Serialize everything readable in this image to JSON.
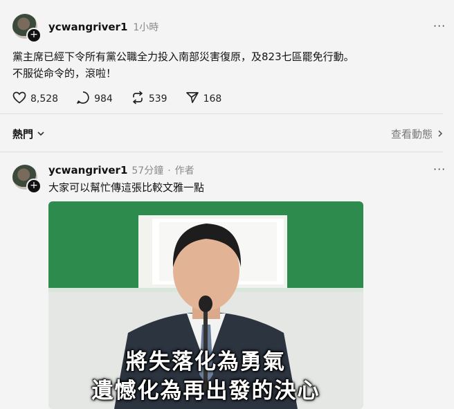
{
  "post": {
    "username": "ycwangriver1",
    "time": "1小時",
    "text_line1": "黨主席已經下令所有黨公職全力投入南部災害復原，及823七區罷免行動。",
    "text_line2": "不服從命令的，滾啦！",
    "likes": "8,528",
    "comments": "984",
    "reposts": "539",
    "shares": "168",
    "more_label": "···"
  },
  "replies_bar": {
    "sort_label": "熱門",
    "activity_label": "查看動態"
  },
  "reply": {
    "username": "ycwangriver1",
    "time": "57分鐘",
    "separator": "·",
    "author_tag": "作者",
    "text": "大家可以幫忙傳這張比較文雅一點",
    "more_label": "···",
    "image_caption_line1": "將失落化為勇氣",
    "image_caption_line2": "遺憾化為再出發的決心"
  },
  "icons": [
    "heart-icon",
    "comment-icon",
    "repost-icon",
    "share-icon",
    "chevron-down-icon",
    "chevron-right-icon",
    "plus-icon"
  ],
  "colors": {
    "background": "#f4f4f4",
    "text": "#111111",
    "muted": "#8a8a8a",
    "green_banner": "#2e8b4e"
  }
}
